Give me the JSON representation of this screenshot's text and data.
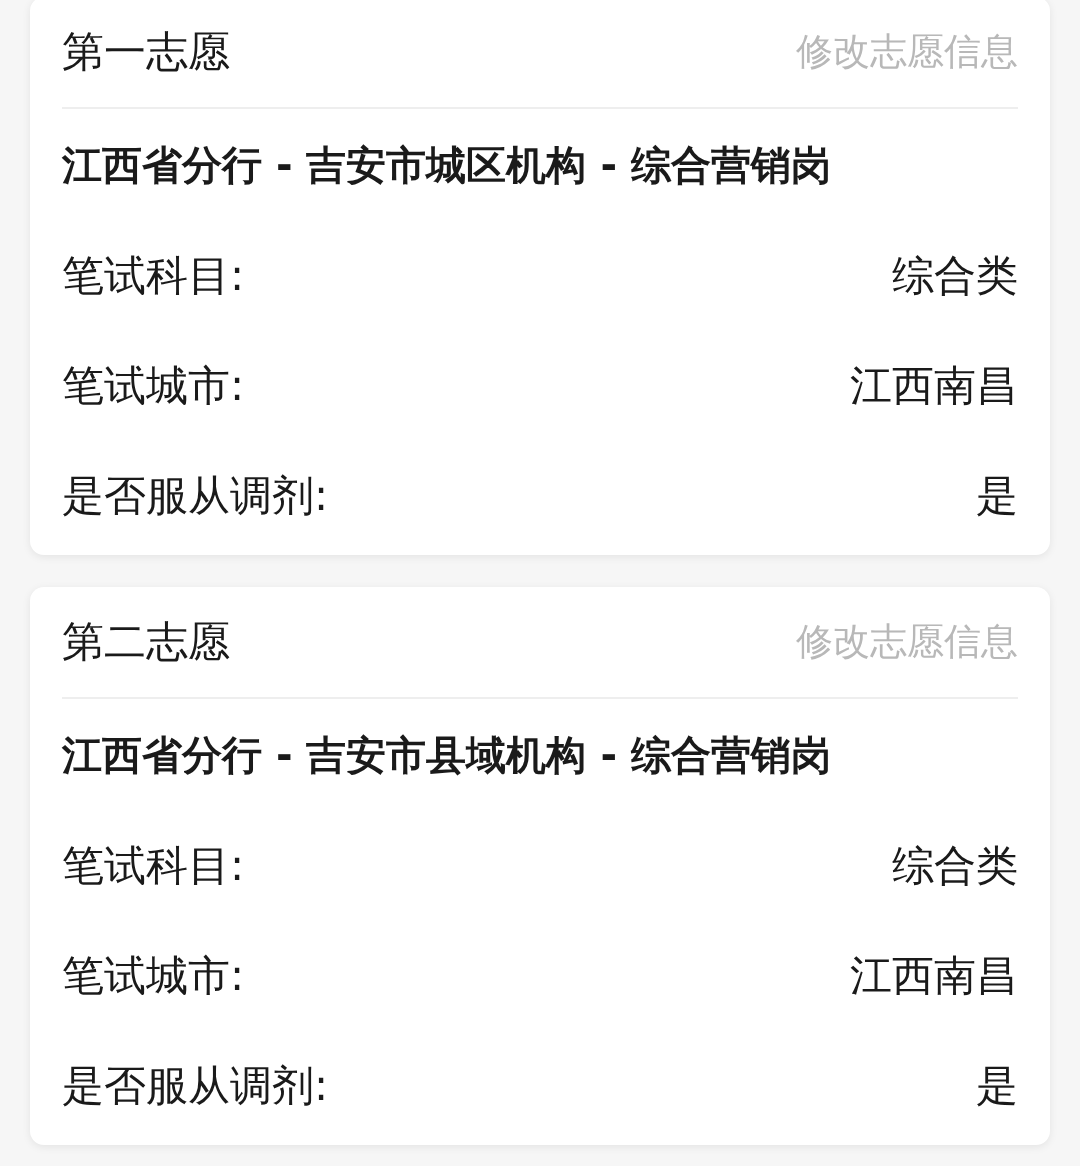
{
  "cards": [
    {
      "heading": "第一志愿",
      "action": "修改志愿信息",
      "position": "江西省分行 - 吉安市城区机构 - 综合营销岗",
      "fields": [
        {
          "label": "笔试科目:",
          "value": "综合类"
        },
        {
          "label": "笔试城市:",
          "value": "江西南昌"
        },
        {
          "label": "是否服从调剂:",
          "value": "是"
        }
      ]
    },
    {
      "heading": "第二志愿",
      "action": "修改志愿信息",
      "position": "江西省分行 - 吉安市县域机构 - 综合营销岗",
      "fields": [
        {
          "label": "笔试科目:",
          "value": "综合类"
        },
        {
          "label": "笔试城市:",
          "value": "江西南昌"
        },
        {
          "label": "是否服从调剂:",
          "value": "是"
        }
      ]
    }
  ]
}
